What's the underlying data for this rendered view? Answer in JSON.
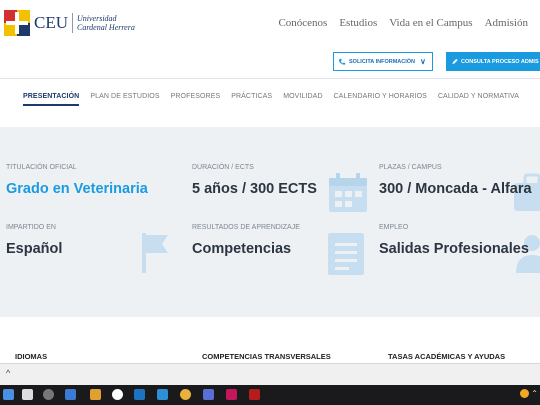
{
  "brand": {
    "name": "CEU",
    "sub_line1": "Universidad",
    "sub_line2": "Cardenal Herrera"
  },
  "topnav": [
    "Conócenos",
    "Estudios",
    "Vida en el Campus",
    "Admisión"
  ],
  "cta": {
    "info_label": "SOLICITA INFORMACIÓN",
    "consult_label": "CONSULTA PROCESO ADMIS"
  },
  "subnav": [
    "PRESENTACIÓN",
    "PLAN DE ESTUDIOS",
    "PROFESORES",
    "PRÁCTICAS",
    "MOVILIDAD",
    "CALENDARIO Y HORARIOS",
    "CALIDAD Y NORMATIVA"
  ],
  "info": {
    "titulacion": {
      "label": "TITULACIÓN OFICIAL",
      "value": "Grado en Veterinaria"
    },
    "duracion": {
      "label": "DURACIÓN / ECTS",
      "value": "5 años / 300 ECTS"
    },
    "plazas": {
      "label": "PLAZAS / CAMPUS",
      "value": "300 / Moncada - Alfara"
    },
    "impartido": {
      "label": "IMPARTIDO EN",
      "value": "Español"
    },
    "resultados": {
      "label": "RESULTADOS DE APRENDIZAJE",
      "value": "Competencias"
    },
    "empleo": {
      "label": "EMPLEO",
      "value": "Salidas Profesionales"
    }
  },
  "bottom_headings": [
    "IDIOMAS",
    "COMPETENCIAS TRANSVERSALES",
    "TASAS ACADÉMICAS Y AYUDAS"
  ],
  "status": {
    "expand_glyph": "^"
  },
  "colors": {
    "accent": "#1a9be0",
    "navy": "#1d3a6b",
    "panel": "#eef1f4",
    "icon_tint": "#c3ddf0"
  }
}
